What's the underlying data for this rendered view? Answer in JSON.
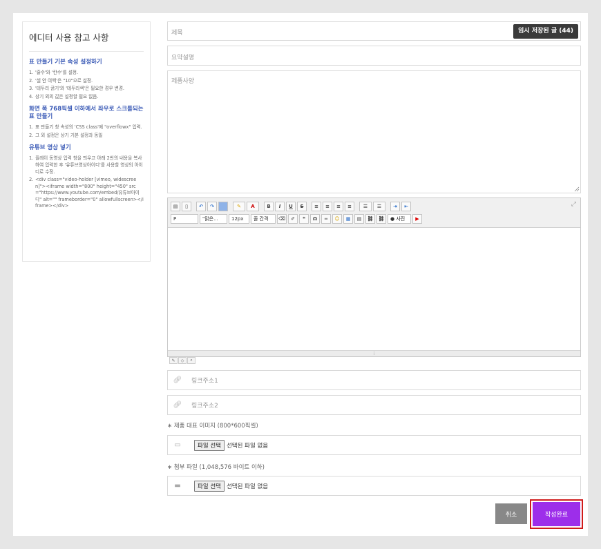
{
  "sidebar": {
    "title": "에디터 사용 참고 사항",
    "sections": [
      {
        "heading": "표 만들기 기본 속성 설정하기",
        "items": [
          "'줄수'와 '칸수'를 설정.",
          "'셀 안 여백'은 \"10\"으로 설정.",
          "'테두리 굵기'와 '테두리색'은 필요한 경우 변경.",
          "상기 외의 값은 설정할 필요 없음."
        ]
      },
      {
        "heading": "화면 폭 768픽셀 이하에서 좌우로 스크롤되는 표 만들기",
        "items": [
          "표 만들기 창 속성의 'CSS class'에 \"overflowx\" 입력.",
          "그 외 설정은 상기 기본 설정과 동일"
        ]
      },
      {
        "heading": "유튜브 영상 넣기",
        "items": [
          "플레이 동영상 입력 창을 띄우고 아래 2번의 내용을 복사하여 입력한 후 '유튜브영상아이디'를 사용할 영상의 아이디로 수정.",
          "<div class=\"video-holder [vimeo, widescreen]\"><iframe width=\"800\" height=\"450\" src=\"https://www.youtube.com/embed/유튜브아이디\" alt=\"\" frameborder=\"0\" allowfullscreen></iframe></div>"
        ]
      }
    ]
  },
  "form": {
    "title_placeholder": "제목",
    "temp_saved_label": "임시 저장된 글 (44)",
    "summary_placeholder": "요약설명",
    "spec_placeholder": "제품사양",
    "link1_placeholder": "링크주소1",
    "link2_placeholder": "링크주소2",
    "image_note": "∗ 제품 대표 이미지 (800*600픽셀)",
    "attach_note": "∗ 첨부 파일 (1,048,576 바이트 이하)",
    "file_button": "파일 선택",
    "file_status": "선택된 파일 없음",
    "cancel_label": "취소",
    "submit_label": "작성완료"
  },
  "editor": {
    "format_select": "P",
    "font_select": "\"맑은...",
    "size_select": "12px",
    "spacing_select": "줄 간격",
    "photo_label": "사진"
  },
  "colors": {
    "submit": "#9d2eea",
    "cancel": "#888888",
    "accent_heading": "#3a5ab6",
    "highlight_outline": "#d01b1b"
  }
}
